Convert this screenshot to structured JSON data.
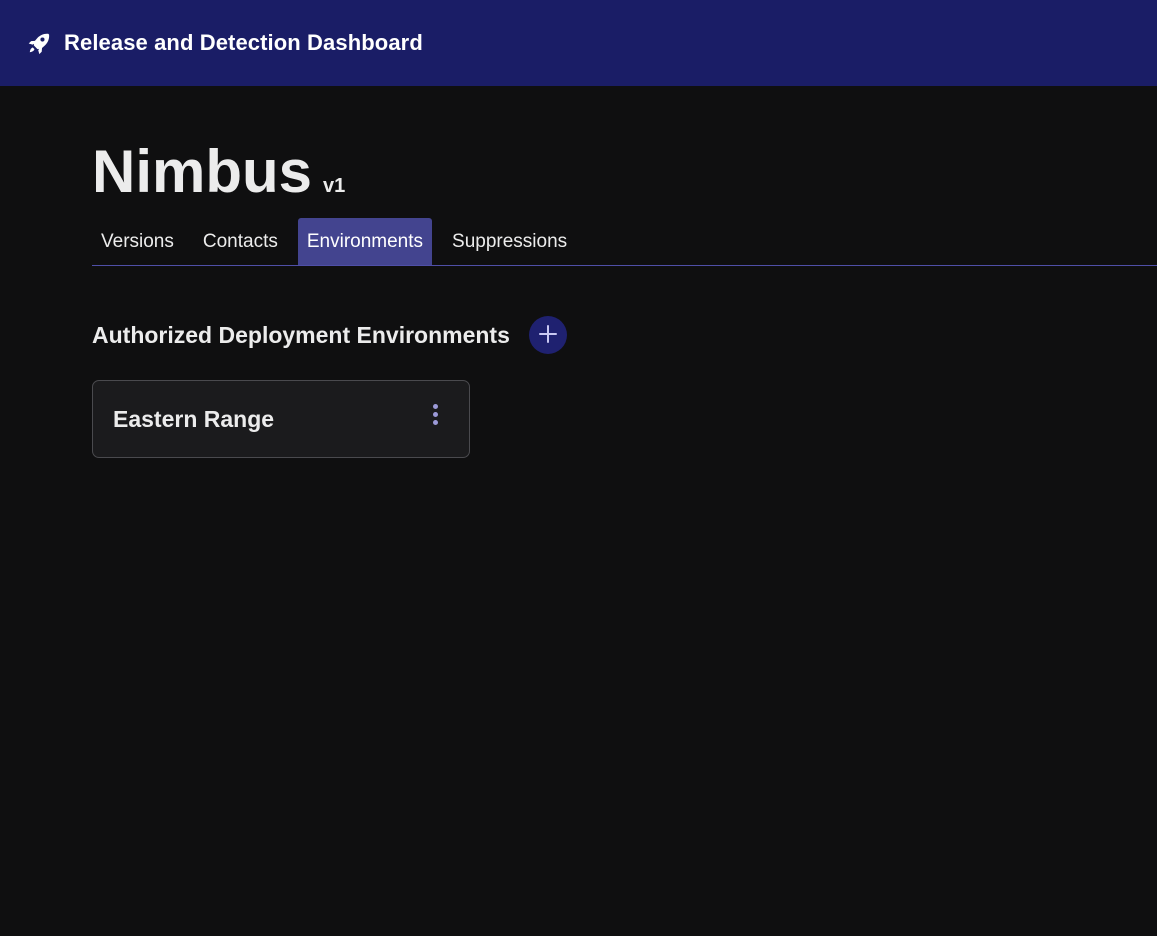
{
  "app": {
    "title": "Release and Detection Dashboard",
    "logo_icon": "rocket-icon",
    "header_color": "#1a1d66"
  },
  "project": {
    "name": "Nimbus",
    "version": "v1"
  },
  "tabs": [
    {
      "label": "Versions",
      "active": false
    },
    {
      "label": "Contacts",
      "active": false
    },
    {
      "label": "Environments",
      "active": true
    },
    {
      "label": "Suppressions",
      "active": false
    }
  ],
  "section": {
    "title": "Authorized Deployment Environments",
    "add_icon": "plus-icon"
  },
  "environments": [
    {
      "name": "Eastern Range",
      "menu_icon": "more-vertical-icon"
    }
  ],
  "colors": {
    "accent": "#43448f",
    "background": "#0f0f10",
    "card": "#1b1b1d"
  }
}
